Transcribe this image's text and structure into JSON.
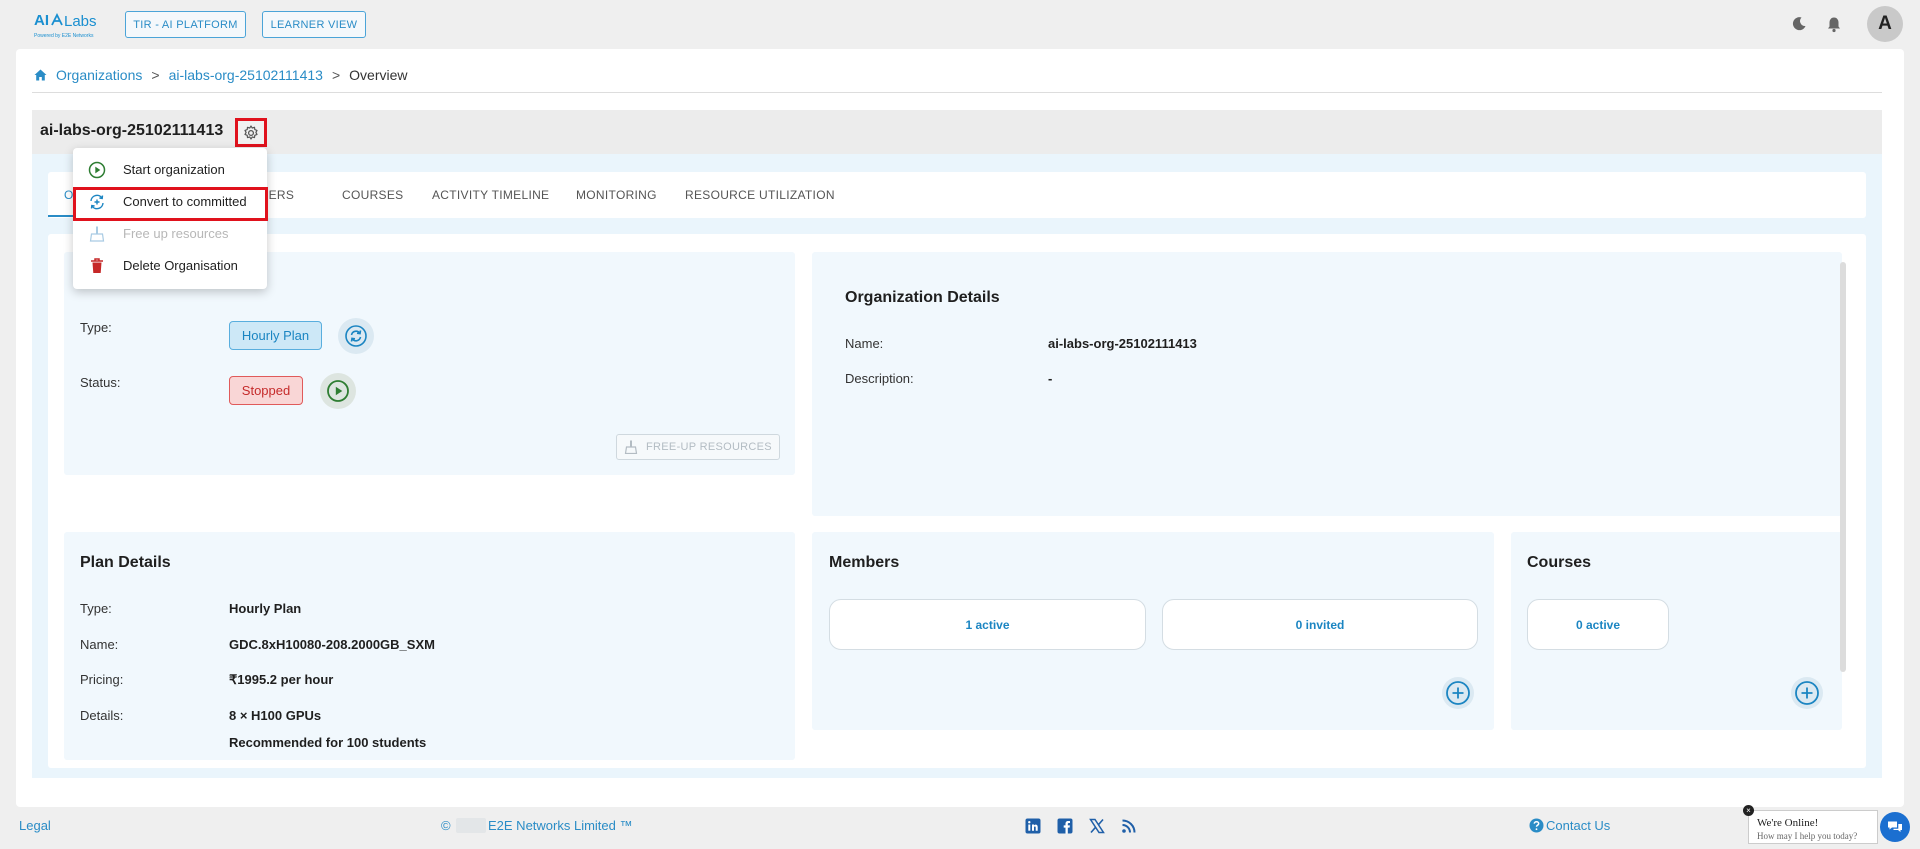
{
  "app": {
    "logo_text_a": "AI",
    "logo_text_b": "Labs",
    "logo_sub": "Powered by E2E Networks",
    "nav_buttons": [
      "TIR - AI PLATFORM",
      "LEARNER VIEW"
    ],
    "avatar_initial": "A"
  },
  "breadcrumb": {
    "items": [
      "Organizations",
      "ai-labs-org-25102111413",
      "Overview"
    ],
    "separator": ">"
  },
  "org": {
    "title": "ai-labs-org-25102111413"
  },
  "tabs": [
    "O",
    "MBERS",
    "COURSES",
    "ACTIVITY TIMELINE",
    "MONITORING",
    "RESOURCE UTILIZATION"
  ],
  "dropdown": {
    "items": [
      {
        "label": "Start organization",
        "icon": "play-circle-icon",
        "disabled": false
      },
      {
        "label": "Convert to committed",
        "icon": "convert-icon",
        "disabled": false
      },
      {
        "label": "Free up resources",
        "icon": "broom-icon",
        "disabled": true
      },
      {
        "label": "Delete Organisation",
        "icon": "trash-icon",
        "disabled": false
      }
    ]
  },
  "status_panel": {
    "type_label": "Type:",
    "type_value": "Hourly Plan",
    "status_label": "Status:",
    "status_value": "Stopped",
    "free_up_button": "FREE-UP RESOURCES"
  },
  "org_details": {
    "title": "Organization Details",
    "name_label": "Name:",
    "name_value": "ai-labs-org-25102111413",
    "desc_label": "Description:",
    "desc_value": "-"
  },
  "plan_details": {
    "title": "Plan Details",
    "type_label": "Type:",
    "type_value": "Hourly Plan",
    "name_label": "Name:",
    "name_value": "GDC.8xH10080-208.2000GB_SXM",
    "pricing_label": "Pricing:",
    "pricing_value": "₹1995.2 per hour",
    "details_label": "Details:",
    "details_value_1": "8 × H100 GPUs",
    "details_value_2": "Recommended for 100 students"
  },
  "members": {
    "title": "Members",
    "active": "1 active",
    "invited": "0 invited"
  },
  "courses": {
    "title": "Courses",
    "active": "0 active"
  },
  "footer": {
    "legal": "Legal",
    "copyright_symbol": "©",
    "company": "E2E Networks Limited ™",
    "contact": "Contact Us"
  },
  "chat": {
    "title": "We're Online!",
    "subtitle": "How may I help you today?",
    "close": "×"
  },
  "colors": {
    "accent": "#2a8cc6",
    "danger": "#e0121d",
    "success": "#2e7d32"
  }
}
